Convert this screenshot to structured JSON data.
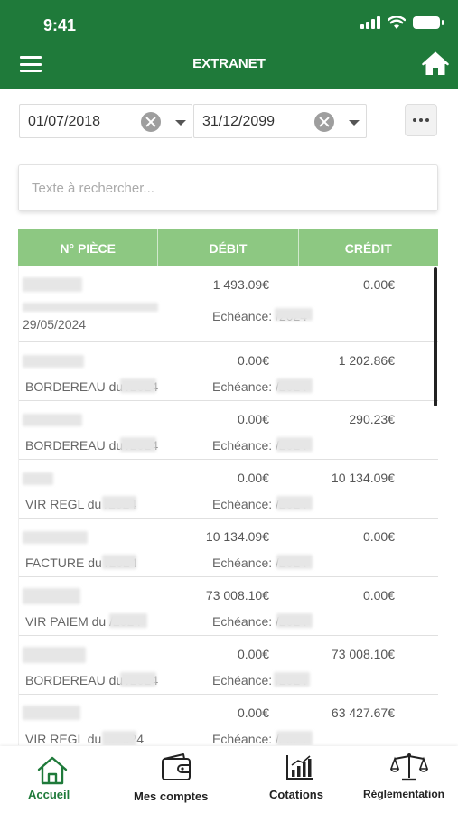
{
  "status_bar": {
    "time": "9:41"
  },
  "app_bar": {
    "title": "EXTRANET"
  },
  "filters": {
    "start_date": "01/07/2018",
    "end_date": "31/12/2099"
  },
  "search": {
    "placeholder": "Texte à rechercher..."
  },
  "table": {
    "headers": [
      "N° PIÈCE",
      "DÉBIT",
      "CRÉDIT"
    ],
    "rows": [
      {
        "debit": "1 493.09€",
        "credit": "0.00€",
        "label": "29/05/2024",
        "due": "Echéance:        /2024"
      },
      {
        "debit": "0.00€",
        "credit": "1 202.86€",
        "label": "BORDEREAU du        /2024",
        "due": "Echéance:        /2024"
      },
      {
        "debit": "0.00€",
        "credit": "290.23€",
        "label": "BORDEREAU du        /2024",
        "due": "Echéance:        /2024"
      },
      {
        "debit": "0.00€",
        "credit": "10 134.09€",
        "label": "VIR REGL du        /2024",
        "due": "Echéance:        /2024"
      },
      {
        "debit": "10 134.09€",
        "credit": "0.00€",
        "label": "FACTURE du        /2024",
        "due": "Echéance:        /2024"
      },
      {
        "debit": "73 008.10€",
        "credit": "0.00€",
        "label": "VIR PAIEM du        /2024",
        "due": "Echéance:        /2024"
      },
      {
        "debit": "0.00€",
        "credit": "73 008.10€",
        "label": "BORDEREAU du        /2024",
        "due": "Echéance:        /2024"
      },
      {
        "debit": "0.00€",
        "credit": "63 427.67€",
        "label": "VIR REGL du        4/2024",
        "due": "Echéance:        /2024"
      }
    ]
  },
  "bottom_nav": {
    "items": [
      {
        "label": "Accueil",
        "icon": "home-outline-icon",
        "active": true
      },
      {
        "label": "Mes comptes",
        "icon": "wallet-icon",
        "active": false
      },
      {
        "label": "Cotations",
        "icon": "bar-chart-icon",
        "active": false
      },
      {
        "label": "Réglementation",
        "icon": "scales-icon",
        "active": false
      }
    ]
  },
  "colors": {
    "brand_green": "#1f7a3a",
    "header_green": "#8dc882",
    "active_nav": "#1f7a3a"
  }
}
